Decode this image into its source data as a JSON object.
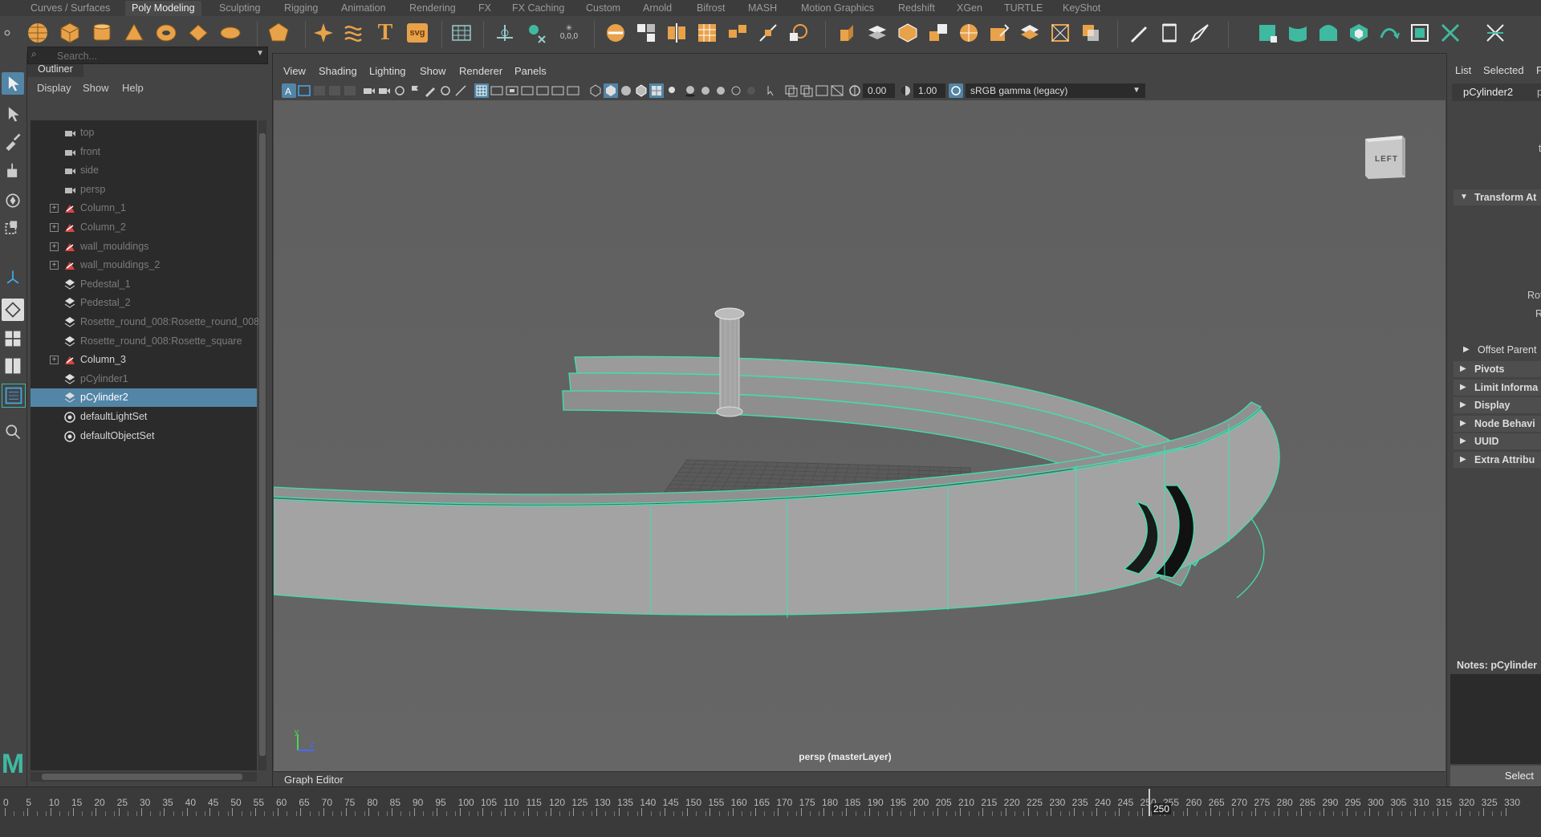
{
  "shelf_tabs": [
    "Curves / Surfaces",
    "Poly Modeling",
    "Sculpting",
    "Rigging",
    "Animation",
    "Rendering",
    "FX",
    "FX Caching",
    "Custom",
    "Arnold",
    "Bifrost",
    "MASH",
    "Motion Graphics",
    "Redshift",
    "XGen",
    "TURTLE",
    "KeyShot"
  ],
  "active_shelf_tab": "Poly Modeling",
  "shelf_text_icons": {
    "text_tool": "T",
    "svg_tool": "svg",
    "coord": "0,0,0"
  },
  "outliner": {
    "title": "Outliner",
    "menu": [
      "Display",
      "Show",
      "Help"
    ],
    "search_placeholder": "Search...",
    "items": [
      {
        "label": "top",
        "type": "camera",
        "state": "dim"
      },
      {
        "label": "front",
        "type": "camera",
        "state": "dim"
      },
      {
        "label": "side",
        "type": "camera",
        "state": "dim"
      },
      {
        "label": "persp",
        "type": "camera",
        "state": "dim"
      },
      {
        "label": "Column_1",
        "type": "group",
        "state": "dim",
        "expandable": true
      },
      {
        "label": "Column_2",
        "type": "group",
        "state": "dim",
        "expandable": true
      },
      {
        "label": "wall_mouldings",
        "type": "group",
        "state": "dim",
        "expandable": true
      },
      {
        "label": "wall_mouldings_2",
        "type": "group",
        "state": "dim",
        "expandable": true
      },
      {
        "label": "Pedestal_1",
        "type": "mesh",
        "state": "dim"
      },
      {
        "label": "Pedestal_2",
        "type": "mesh",
        "state": "dim"
      },
      {
        "label": "Rosette_round_008:Rosette_round_008",
        "type": "mesh",
        "state": "dim"
      },
      {
        "label": "Rosette_round_008:Rosette_square",
        "type": "mesh",
        "state": "dim"
      },
      {
        "label": "Column_3",
        "type": "group",
        "state": "normal",
        "expandable": true
      },
      {
        "label": "pCylinder1",
        "type": "mesh",
        "state": "dim"
      },
      {
        "label": "pCylinder2",
        "type": "mesh",
        "state": "selected"
      },
      {
        "label": "defaultLightSet",
        "type": "set",
        "state": "normal"
      },
      {
        "label": "defaultObjectSet",
        "type": "set",
        "state": "normal"
      }
    ]
  },
  "viewport": {
    "menu": [
      "View",
      "Shading",
      "Lighting",
      "Show",
      "Renderer",
      "Panels"
    ],
    "exposure": "0.00",
    "gamma": "1.00",
    "color_space": "sRGB gamma (legacy)",
    "camera_label": "persp (masterLayer)",
    "viewcube_label": "LEFT",
    "axis_labels": {
      "y": "y",
      "z": "z"
    }
  },
  "graph_editor_label": "Graph Editor",
  "attribute_editor": {
    "menu": [
      "List",
      "Selected",
      "F"
    ],
    "node_tab": "pCylinder2",
    "node_tab_2": "pC",
    "partial_labels": {
      "t": "t",
      "rot": "Rot",
      "r": "R"
    },
    "sections_expanded": [
      "Transform At"
    ],
    "offset_parent": "Offset Parent",
    "sections": [
      "Pivots",
      "Limit Informa",
      "Display",
      "Node Behavi",
      "UUID",
      "Extra Attribu"
    ],
    "notes_label": "Notes:  pCylinder",
    "select_button": "Select"
  },
  "timeline": {
    "start": 0,
    "end": 330,
    "step": 5,
    "current_frame": "250"
  },
  "colors": {
    "wireframe_highlight": "#3fe0b0",
    "selection_blue": "#5285a6",
    "shelf_orange": "#e8a24a",
    "shelf_teal": "#3fb9a0"
  }
}
